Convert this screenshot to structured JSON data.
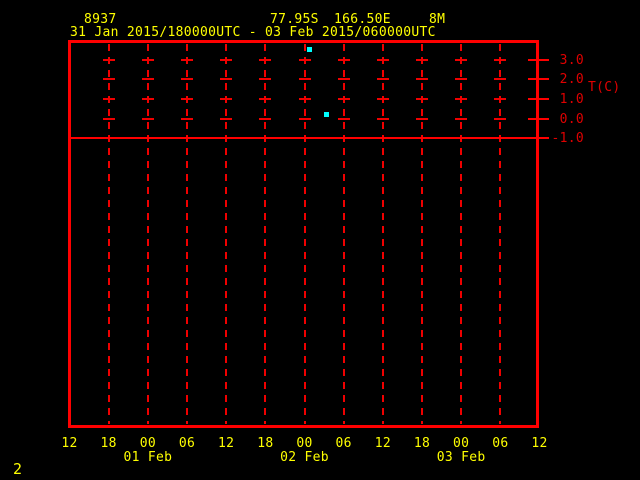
{
  "header": {
    "station_id": "8937",
    "latitude": "77.95S",
    "longitude": "166.50E",
    "elevation": "8M",
    "time_range": "31 Jan 2015/180000UTC - 03 Feb 2015/060000UTC"
  },
  "page_number": "2",
  "y_axis": {
    "title": "T(C)",
    "ticks": [
      {
        "label": "3.0",
        "value": 3.0
      },
      {
        "label": "2.0",
        "value": 2.0
      },
      {
        "label": "1.0",
        "value": 1.0
      },
      {
        "label": "0.0",
        "value": 0.0
      },
      {
        "label": "-1.0",
        "value": -1.0,
        "reference_line": true
      }
    ]
  },
  "x_axis": {
    "hour_labels": [
      "12",
      "18",
      "00",
      "06",
      "12",
      "18",
      "00",
      "06",
      "12",
      "18",
      "00",
      "06",
      "12"
    ],
    "date_labels": [
      {
        "label": "01 Feb",
        "tick_index": 2
      },
      {
        "label": "02 Feb",
        "tick_index": 6
      },
      {
        "label": "03 Feb",
        "tick_index": 10
      }
    ]
  },
  "chart_data": {
    "type": "scatter",
    "title": "31 Jan 2015/180000UTC - 03 Feb 2015/060000UTC",
    "station": {
      "id": "8937",
      "lat": "77.95S",
      "lon": "166.50E",
      "elev": "8M"
    },
    "ylabel": "T(C)",
    "x_start": "31 Jan 2015 12:00 UTC",
    "x_end": "03 Feb 2015 12:00 UTC",
    "x_tick_interval_hours": 6,
    "x_tick_hours": [
      "12",
      "18",
      "00",
      "06",
      "12",
      "18",
      "00",
      "06",
      "12",
      "18",
      "00",
      "06",
      "12"
    ],
    "yticks_labeled": [
      3.0,
      2.0,
      1.0,
      0.0,
      -1.0
    ],
    "reference_line_y": -1.0,
    "grid": true,
    "series": [
      {
        "name": "temperature-observations",
        "color": "#00ffff",
        "points": [
          {
            "hours_from_x_start": 36.8,
            "temp_c": 3.5
          },
          {
            "hours_from_x_start": 39.4,
            "temp_c": 0.2
          }
        ]
      }
    ]
  },
  "colors": {
    "background": "#000000",
    "frame": "#ff0000",
    "gridline": "#f00000",
    "axis_text": "#e00000",
    "label_text": "#ffff00",
    "point": "#00ffff"
  }
}
